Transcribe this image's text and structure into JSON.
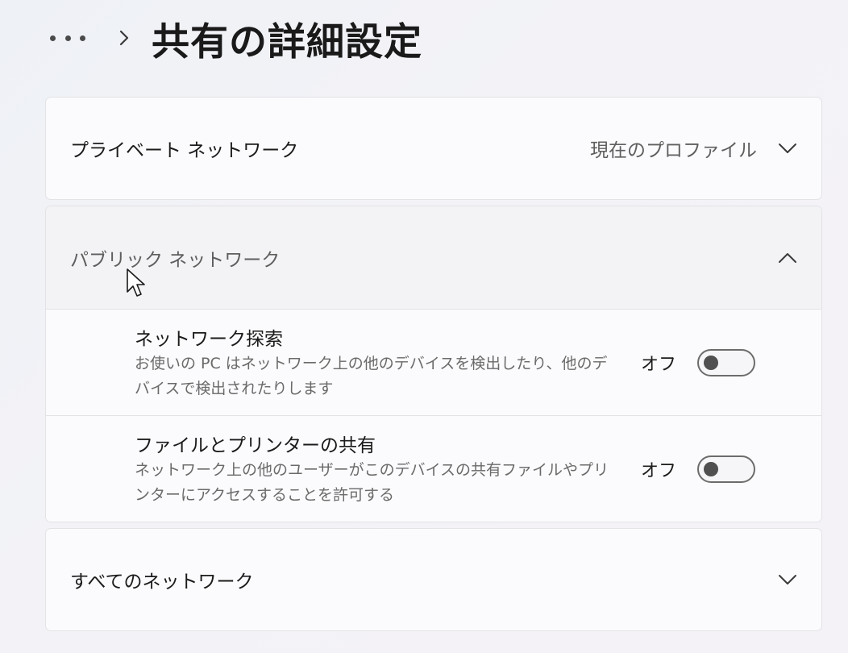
{
  "header": {
    "more_icon": "more-horizontal-icon",
    "separator_icon": "chevron-right-icon",
    "title": "共有の詳細設定"
  },
  "sections": {
    "private": {
      "title": "プライベート ネットワーク",
      "status": "現在のプロファイル",
      "expanded": false,
      "icon": "chevron-down-icon"
    },
    "public": {
      "title": "パブリック ネットワーク",
      "expanded": true,
      "icon": "chevron-up-icon",
      "settings": [
        {
          "title": "ネットワーク探索",
          "description": "お使いの PC はネットワーク上の他のデバイスを検出したり、他のデバイスで検出されたりします",
          "state_label": "オフ",
          "on": false
        },
        {
          "title": "ファイルとプリンターの共有",
          "description": "ネットワーク上の他のユーザーがこのデバイスの共有ファイルやプリンターにアクセスすることを許可する",
          "state_label": "オフ",
          "on": false
        }
      ]
    },
    "all": {
      "title": "すべてのネットワーク",
      "expanded": false,
      "icon": "chevron-down-icon"
    }
  },
  "colors": {
    "background": "#f1f2f6",
    "card": "#fbfbfd",
    "expanded_header": "#f3f3f5",
    "text_primary": "#1b1b1b",
    "text_secondary": "#6a6a6a",
    "toggle_off_border": "#6c6c6c",
    "toggle_off_knob": "#505050"
  },
  "cursor_icon": "mouse-pointer-arrow-icon"
}
